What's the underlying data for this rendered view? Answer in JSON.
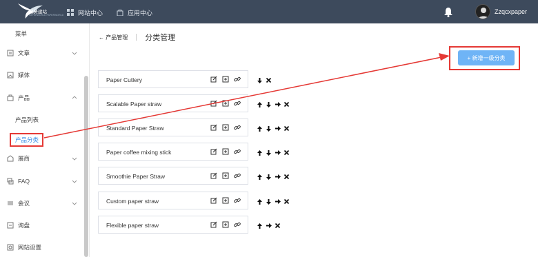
{
  "app": {
    "logo_name": "聚贤建站",
    "logo_sub": "PAPERWORLD PAPERWORLD"
  },
  "topnav": [
    {
      "label": "网站中心",
      "icon": "grid-icon"
    },
    {
      "label": "应用中心",
      "icon": "bag-icon"
    }
  ],
  "user": {
    "name": "Zzqcxpaper"
  },
  "sidebar": {
    "header": "菜单",
    "items": [
      {
        "label": "文章",
        "icon": "article-icon",
        "chevron": "down"
      },
      {
        "label": "媒体",
        "icon": "media-icon",
        "chevron": ""
      },
      {
        "label": "产品",
        "icon": "product-icon",
        "chevron": "up"
      },
      {
        "label": "展商",
        "icon": "exhibitor-icon",
        "chevron": "down"
      },
      {
        "label": "FAQ",
        "icon": "faq-icon",
        "chevron": "down"
      },
      {
        "label": "会议",
        "icon": "meeting-icon",
        "chevron": "down"
      },
      {
        "label": "询盘",
        "icon": "inquiry-icon",
        "chevron": ""
      },
      {
        "label": "网站设置",
        "icon": "settings-icon",
        "chevron": ""
      }
    ],
    "subitems": [
      {
        "label": "产品列表",
        "active": false
      },
      {
        "label": "产品分类",
        "active": true
      }
    ]
  },
  "breadcrumb": {
    "back": "← 产品管理",
    "title": "分类管理"
  },
  "add_button": {
    "label": "+ 新增一级分类"
  },
  "categories": [
    {
      "name": "Paper Cutlery",
      "moves": [
        "down",
        "close"
      ]
    },
    {
      "name": "Scalable Paper straw",
      "moves": [
        "up",
        "down",
        "right",
        "close"
      ]
    },
    {
      "name": "Standard Paper Straw",
      "moves": [
        "up",
        "down",
        "right",
        "close"
      ]
    },
    {
      "name": "Paper coffee mixing stick",
      "moves": [
        "up",
        "down",
        "right",
        "close"
      ]
    },
    {
      "name": "Smoothie Paper Straw",
      "moves": [
        "up",
        "down",
        "right",
        "close"
      ]
    },
    {
      "name": "Custom paper straw",
      "moves": [
        "up",
        "down",
        "right",
        "close"
      ]
    },
    {
      "name": "Flexible paper straw",
      "moves": [
        "up",
        "right",
        "close"
      ]
    }
  ],
  "colors": {
    "topbar": "#3d4a5c",
    "accent": "#6fb4f6",
    "highlight": "#e53935",
    "active_link": "#3a8ee6"
  }
}
